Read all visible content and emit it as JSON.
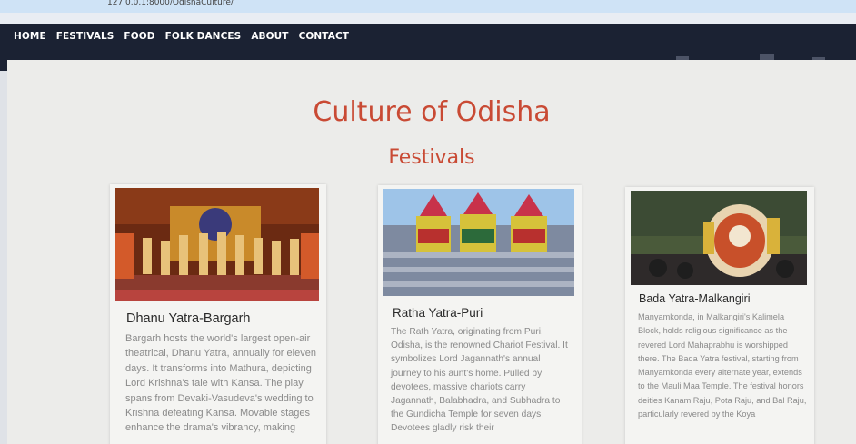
{
  "browser": {
    "url": "127.0.0.1:8000/OdishaCulture/"
  },
  "nav": {
    "links": [
      "HOME",
      "FESTIVALS",
      "FOOD",
      "FOLK DANCES",
      "ABOUT",
      "CONTACT"
    ]
  },
  "page": {
    "title": "Culture of Odisha",
    "section": "Festivals"
  },
  "cards": [
    {
      "title": "Dhanu Yatra-Bargarh",
      "text": "Bargarh hosts the world's largest open-air theatrical, Dhanu Yatra, annually for eleven days. It transforms into Mathura, depicting Lord Krishna's tale with Kansa. The play spans from Devaki-Vasudeva's wedding to Krishna defeating Kansa. Movable stages enhance the drama's vibrancy, making"
    },
    {
      "title": "Ratha Yatra-Puri",
      "text": "The Rath Yatra, originating from Puri, Odisha, is the renowned Chariot Festival. It symbolizes Lord Jagannath's annual journey to his aunt's home. Pulled by devotees, massive chariots carry Jagannath, Balabhadra, and Subhadra to the Gundicha Temple for seven days. Devotees gladly risk their"
    },
    {
      "title": "Bada Yatra-Malkangiri",
      "text": "Manyamkonda, in Malkangiri's Kalimela Block, holds religious significance as the revered Lord Mahaprabhu is worshipped there. The Bada Yatra festival, starting from Manyamkonda every alternate year, extends to the Mauli Maa Temple. The festival honors deities Kanam Raju, Pota Raju, and Bal Raju, particularly revered by the Koya"
    }
  ],
  "colors": {
    "accent": "#c94a34",
    "navbar": "#1b2233",
    "background": "#ececea"
  },
  "icons": [
    "bookmark-star-icon"
  ]
}
